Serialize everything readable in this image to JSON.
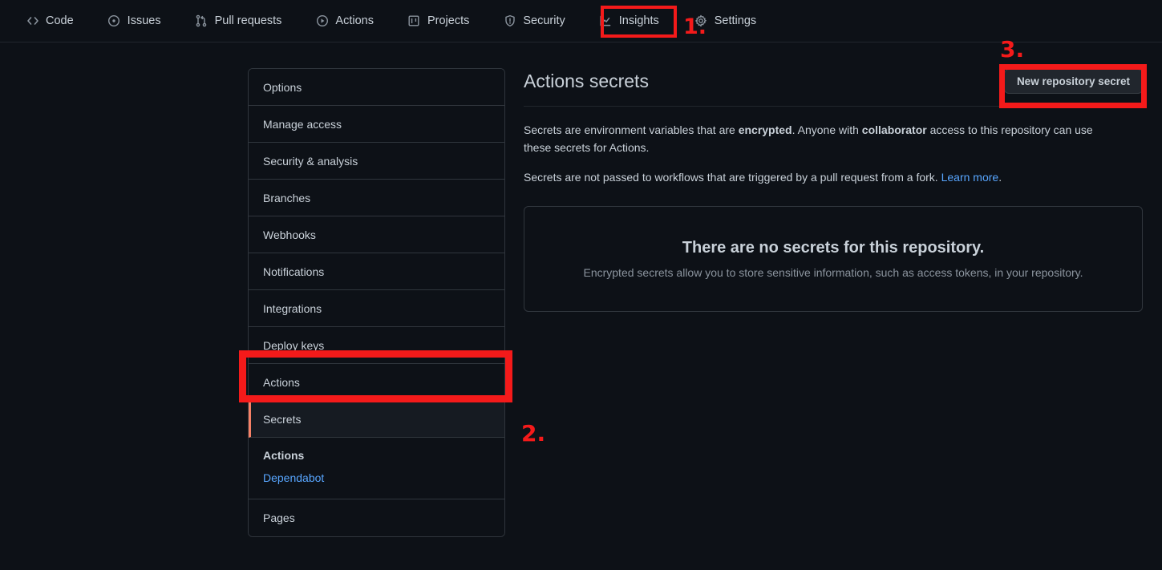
{
  "repo_nav": {
    "items": [
      {
        "label": "Code",
        "icon": "code-icon",
        "selected": false
      },
      {
        "label": "Issues",
        "icon": "issue-opened-icon",
        "selected": false
      },
      {
        "label": "Pull requests",
        "icon": "git-pull-request-icon",
        "selected": false
      },
      {
        "label": "Actions",
        "icon": "play-icon",
        "selected": false
      },
      {
        "label": "Projects",
        "icon": "project-board-icon",
        "selected": false
      },
      {
        "label": "Security",
        "icon": "shield-icon",
        "selected": false
      },
      {
        "label": "Insights",
        "icon": "graph-icon",
        "selected": false
      },
      {
        "label": "Settings",
        "icon": "gear-icon",
        "selected": true
      }
    ]
  },
  "annotations": {
    "step1": "1.",
    "step2": "2.",
    "step3": "3.",
    "highlight_color": "#f41a1a"
  },
  "sidebar": {
    "items": [
      {
        "label": "Options",
        "selected": false
      },
      {
        "label": "Manage access",
        "selected": false
      },
      {
        "label": "Security & analysis",
        "selected": false
      },
      {
        "label": "Branches",
        "selected": false
      },
      {
        "label": "Webhooks",
        "selected": false
      },
      {
        "label": "Notifications",
        "selected": false
      },
      {
        "label": "Integrations",
        "selected": false
      },
      {
        "label": "Deploy keys",
        "selected": false
      },
      {
        "label": "Actions",
        "selected": false
      },
      {
        "label": "Secrets",
        "selected": true
      }
    ],
    "group": {
      "title": "Actions",
      "links": [
        {
          "label": "Dependabot"
        }
      ]
    },
    "footer_item": {
      "label": "Pages"
    }
  },
  "main": {
    "title": "Actions secrets",
    "new_secret_button": "New repository secret",
    "description_1": {
      "part1": "Secrets are environment variables that are ",
      "bold1": "encrypted",
      "part2": ". Anyone with ",
      "bold2": "collaborator",
      "part3": " access to this repository can use these secrets for Actions."
    },
    "description_2": {
      "text": "Secrets are not passed to workflows that are triggered by a pull request from a fork. ",
      "link": "Learn more",
      "tail": "."
    },
    "empty_state": {
      "title": "There are no secrets for this repository.",
      "subtitle": "Encrypted secrets allow you to store sensitive information, such as access tokens, in your repository."
    }
  },
  "theme": {
    "background": "#0d1117",
    "border": "#30363d",
    "text": "#c9d1d9",
    "muted": "#8b949e",
    "link": "#58a6ff",
    "selected_accent": "#f78166"
  }
}
